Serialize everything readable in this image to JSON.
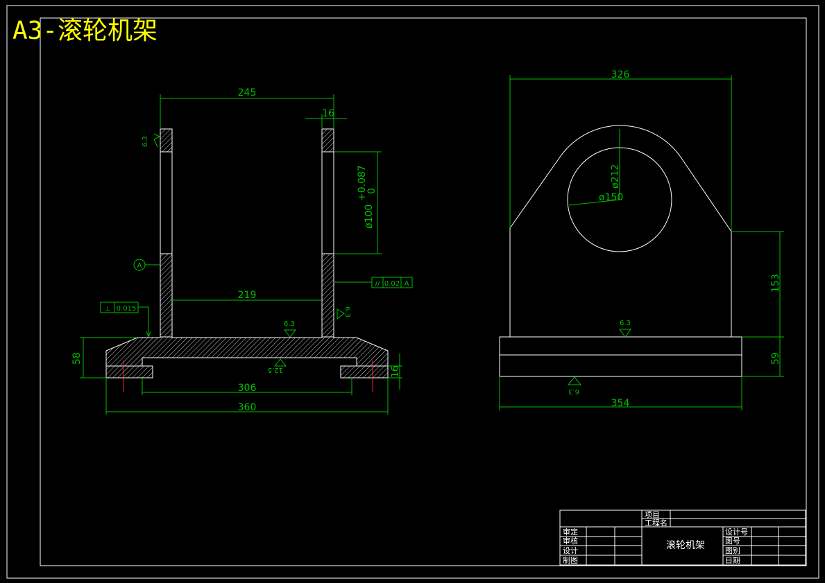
{
  "title": "A3-滚轮机架",
  "colors": {
    "background": "#000000",
    "outline": "#ffffff",
    "dimension": "#00c000",
    "title": "#ffff00",
    "centerline": "#ff2020"
  },
  "front_view": {
    "dims": {
      "top_width": "245",
      "wall": "16",
      "bore": "ø100",
      "tol_upper": "+0.087",
      "tol_lower": "0",
      "inner_width": "219",
      "hole_span": "306",
      "overall_width": "360",
      "base_height": "58",
      "plate_thickness": "16"
    },
    "roughness": {
      "r1": "6.3",
      "r2": "6.3",
      "r3": "6.3",
      "r4": "12.5"
    },
    "datum": "A",
    "fcf_parallel": {
      "symbol": "//",
      "value": "0.02",
      "datum": "A"
    },
    "fcf_perp": {
      "symbol": "⊥",
      "value": "0.015"
    }
  },
  "side_view": {
    "dims": {
      "overall_width": "326",
      "outer_dia": "ø212",
      "bore_dia": "ø150",
      "height": "153",
      "base_height": "59",
      "base_width": "354"
    },
    "roughness": {
      "r1": "6.3",
      "r2": "6.3"
    }
  },
  "title_block": {
    "project": "项目",
    "project_name": "工程名",
    "drawing_name": "滚轮机架",
    "approve": "审定",
    "review": "审核",
    "design": "设计",
    "draw": "制图",
    "design_no": "设计号",
    "drawing_no": "图号",
    "sheet": "图别",
    "date": "日期"
  }
}
